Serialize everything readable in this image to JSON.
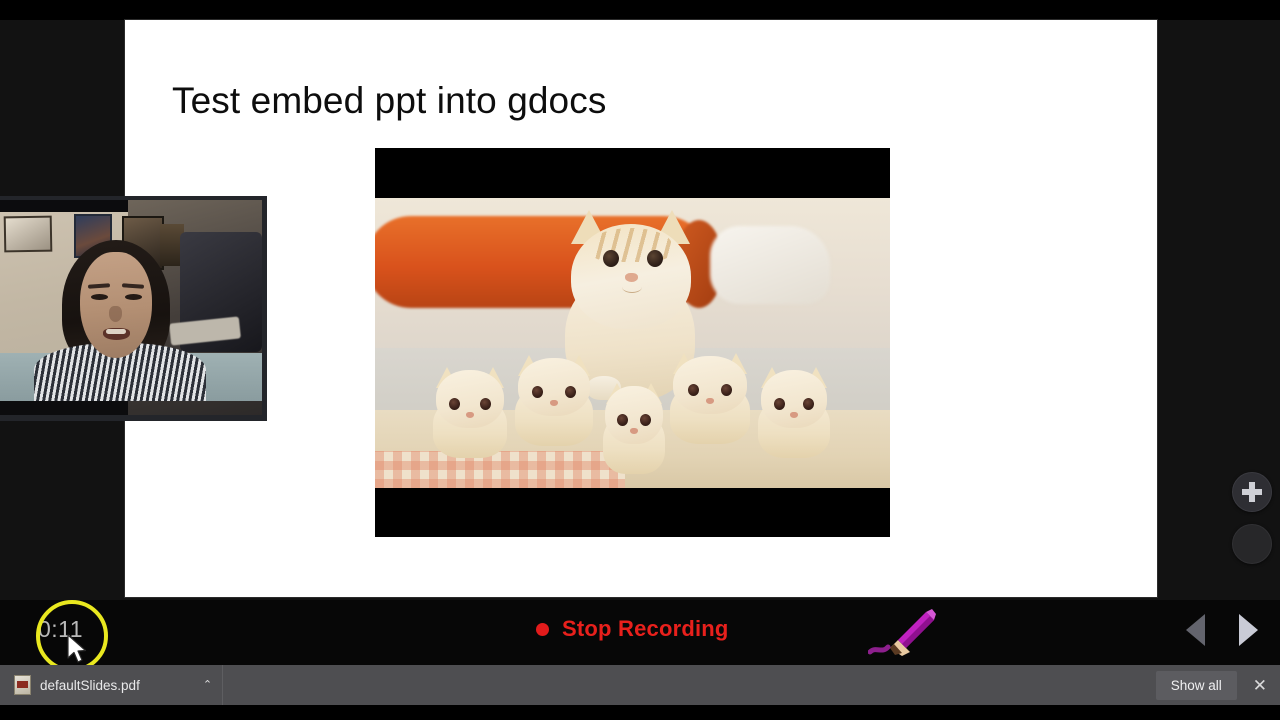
{
  "app": {
    "name": "screen-recording-presentation-viewer"
  },
  "slide": {
    "title": "Test embed ppt into gdocs",
    "media": {
      "name": "cat-and-kittens-video",
      "description": "Mother cat sitting behind five kittens on a carpet",
      "letterboxed": true
    }
  },
  "webcam": {
    "label": "presenter-webcam-feed"
  },
  "zoom_controls": {
    "zoom_in_label": "+",
    "zoom_out_label": ""
  },
  "control_bar": {
    "timer": "0:11",
    "stop_recording_label": "Stop Recording",
    "record_dot_color": "#e21b1b",
    "stop_label_color": "#e8201c",
    "annotation_tool": "pencil",
    "pencil_color": "#b615b6",
    "prev_arrow_label": "Previous slide",
    "next_arrow_label": "Next slide",
    "click_highlight_color": "#e9e81f"
  },
  "download_shelf": {
    "file_name": "defaultSlides.pdf",
    "caret_glyph": "⌃",
    "show_all_label": "Show all",
    "close_glyph": "✕"
  }
}
